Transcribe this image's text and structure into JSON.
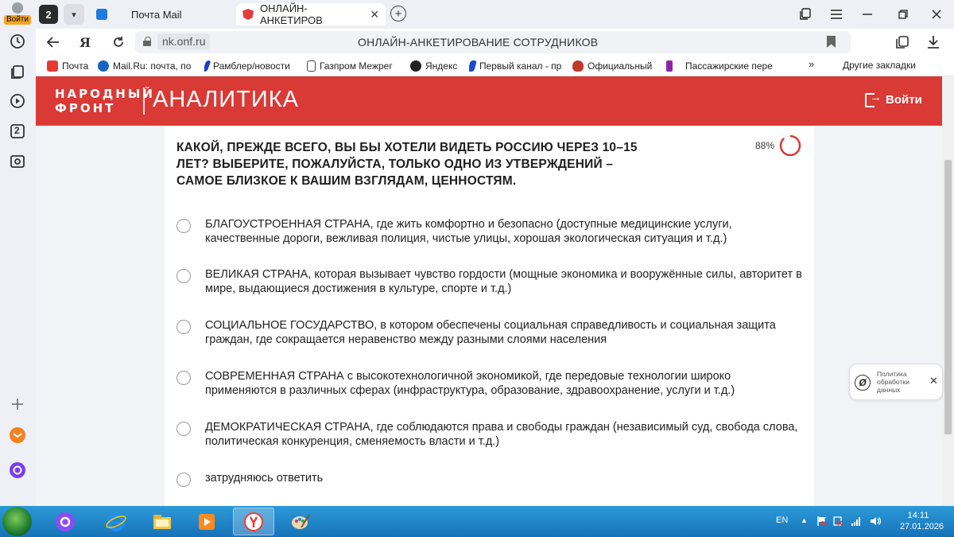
{
  "rail": {
    "login_label": "Войти",
    "tab_badge": "2"
  },
  "tabs": {
    "count": "2",
    "items": [
      {
        "title": "Почта Mail"
      },
      {
        "title": "ОНЛАЙН-АНКЕТИРОВ"
      }
    ]
  },
  "address": {
    "domain": "nk.onf.ru",
    "title": "ОНЛАЙН-АНКЕТИРОВАНИЕ СОТРУДНИКОВ"
  },
  "bookmarks": {
    "items": [
      {
        "label": "Почта",
        "color": "#e53935"
      },
      {
        "label": "Mail.Ru: почта, по",
        "color": "#1565c0"
      },
      {
        "label": "Рамблер/новости",
        "color": "#1e40c8"
      },
      {
        "label": "Газпром Межрег",
        "color": "#444444"
      },
      {
        "label": "Яндекс",
        "color": "#222222"
      },
      {
        "label": "Первый канал - пр",
        "color": "#1e4ad0"
      },
      {
        "label": "Официальный",
        "color": "#c0392b"
      },
      {
        "label": "Пассажирские пере",
        "color": "#8e24aa"
      }
    ],
    "more": "»",
    "other": "Другие закладки"
  },
  "site": {
    "logo_line1": "НАРОДНЫЙ",
    "logo_line2": "ФРОНТ",
    "section": "АНАЛИТИКА",
    "logout": "Войти",
    "brand_color": "#d93a36"
  },
  "survey": {
    "question": "КАКОЙ, ПРЕЖДЕ ВСЕГО, ВЫ БЫ ХОТЕЛИ ВИДЕТЬ РОССИЮ ЧЕРЕЗ 10–15 ЛЕТ? ВЫБЕРИТЕ, ПОЖАЛУЙСТА, ТОЛЬКО ОДНО ИЗ УТВЕРЖДЕНИЙ – САМОЕ БЛИЗКОЕ К ВАШИМ ВЗГЛЯДАМ, ЦЕННОСТЯМ.",
    "progress_label": "88%",
    "progress": 0.88,
    "options": [
      {
        "text": "БЛАГОУСТРОЕННАЯ СТРАНА, где жить комфортно и безопасно (доступные медицинские услуги, качественные дороги, вежливая полиция, чистые улицы, хорошая экологическая ситуация и т.д.)"
      },
      {
        "text": "ВЕЛИКАЯ СТРАНА, которая вызывает чувство гордости (мощные экономика и вооружённые силы, авторитет в мире, выдающиеся достижения в культуре, спорте и т.д.)"
      },
      {
        "text": "СОЦИАЛЬНОЕ ГОСУДАРСТВО, в котором обеспечены социальная справедливость и социальная защита граждан, где сокращается неравенство между разными слоями населения"
      },
      {
        "text": "СОВРЕМЕННАЯ СТРАНА с высокотехнологичной экономикой, где передовые технологии широко применяются в различных сферах (инфраструктура, образование, здравоохранение, услуги и т.д.)"
      },
      {
        "text": "ДЕМОКРАТИЧЕСКАЯ СТРАНА, где соблюдаются права и свободы граждан (независимый суд, свобода слова, политическая конкуренция, сменяемость власти и т.д.)"
      },
      {
        "text": "затрудняюсь ответить"
      }
    ]
  },
  "privacy": {
    "text": "Политика обработки данных"
  },
  "taskbar": {
    "lang": "EN",
    "time": "14:11",
    "date": "27.01.2026"
  }
}
